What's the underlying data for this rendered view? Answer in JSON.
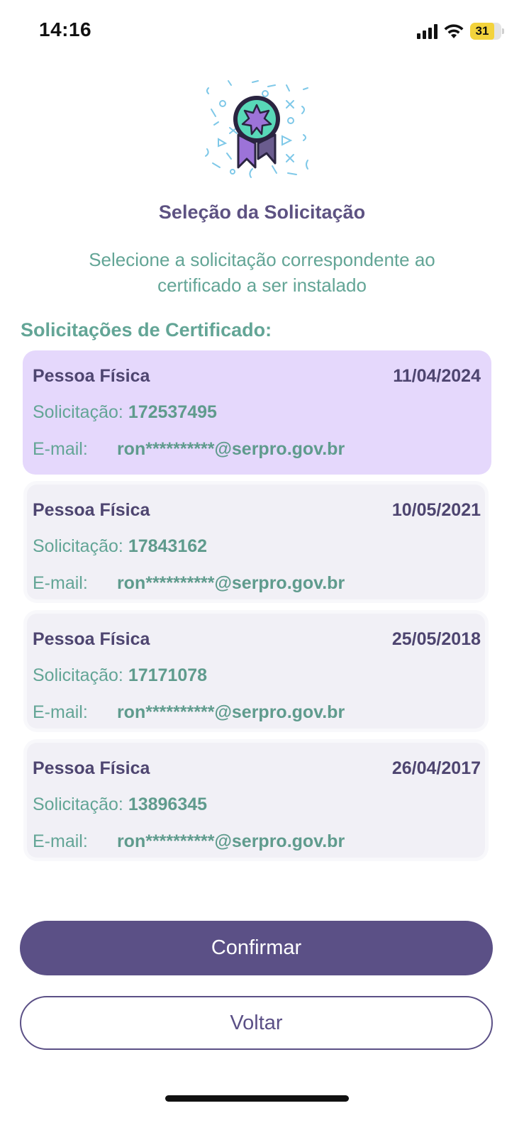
{
  "status_bar": {
    "time": "14:16",
    "battery_level": "31",
    "icons": [
      "cellular-signal-icon",
      "wifi-icon",
      "battery-icon"
    ],
    "battery_color": "#f3d33c"
  },
  "hero": {
    "icon": "award-ribbon-icon"
  },
  "header": {
    "title": "Seleção da Solicitação",
    "subtitle_line1": "Selecione a solicitação correspondente ao",
    "subtitle_line2": "certificado a ser instalado"
  },
  "list": {
    "title": "Solicitações de Certificado:",
    "request_label": "Solicitação:",
    "email_label": "E-mail:",
    "selected_index": 0,
    "items": [
      {
        "type": "Pessoa Física",
        "date": "11/04/2024",
        "request_number": "172537495",
        "email": "ron**********@serpro.gov.br"
      },
      {
        "type": "Pessoa Física",
        "date": "10/05/2021",
        "request_number": "17843162",
        "email": "ron**********@serpro.gov.br"
      },
      {
        "type": "Pessoa Física",
        "date": "25/05/2018",
        "request_number": "17171078",
        "email": "ron**********@serpro.gov.br"
      },
      {
        "type": "Pessoa Física",
        "date": "26/04/2017",
        "request_number": "13896345",
        "email": "ron**********@serpro.gov.br"
      }
    ]
  },
  "buttons": {
    "confirm_label": "Confirmar",
    "back_label": "Voltar"
  },
  "colors": {
    "primary": "#5b5086",
    "accent_green": "#63a596",
    "selected_card": "#e5d8fc",
    "card": "#f1f0f6"
  }
}
